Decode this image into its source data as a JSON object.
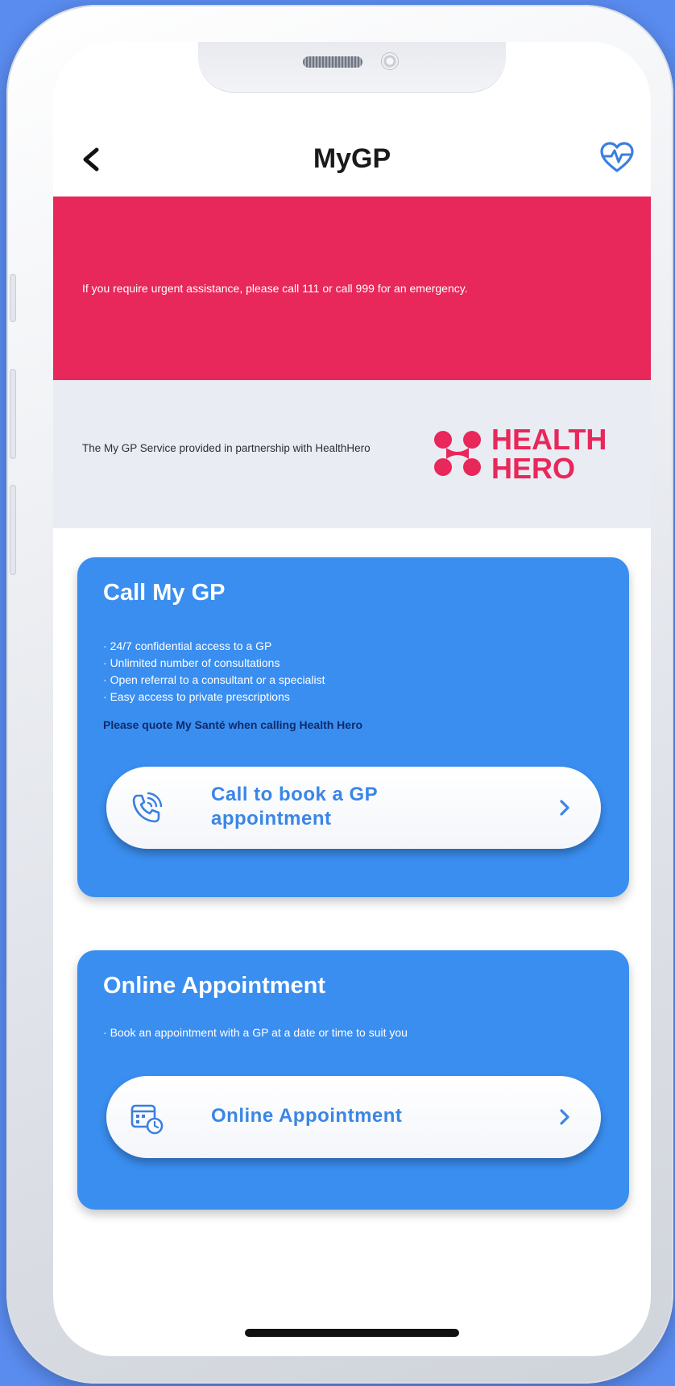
{
  "header": {
    "title": "MyGP"
  },
  "alert": {
    "text": "If you require urgent assistance, please call 111 or call 999 for an emergency."
  },
  "partner": {
    "text": "The My GP Service provided in partnership with HealthHero",
    "logo_line1": "HEALTH",
    "logo_line2": "HERO"
  },
  "call_card": {
    "title": "Call My GP",
    "bullets": [
      "24/7 confidential access to a GP",
      "Unlimited number of consultations",
      "Open referral to a consultant or a specialist",
      "Easy access to private prescriptions"
    ],
    "note": "Please quote My Santé when calling Health Hero",
    "button_label": "Call to book a GP appointment"
  },
  "online_card": {
    "title": "Online Appointment",
    "bullet": "Book an appointment with a GP at a date or time to suit you",
    "button_label": "Online Appointment"
  },
  "icons": {
    "back": "chevron-left-icon",
    "health": "heartbeat-icon",
    "call": "phone-ringing-icon",
    "calendar": "calendar-clock-icon",
    "chevron": "chevron-right-icon"
  },
  "colors": {
    "alert": "#e8275a",
    "card": "#3a8ef0",
    "button_text": "#3a86e6",
    "partner_bg": "#e9ecf3",
    "note": "#0e2b6b"
  }
}
